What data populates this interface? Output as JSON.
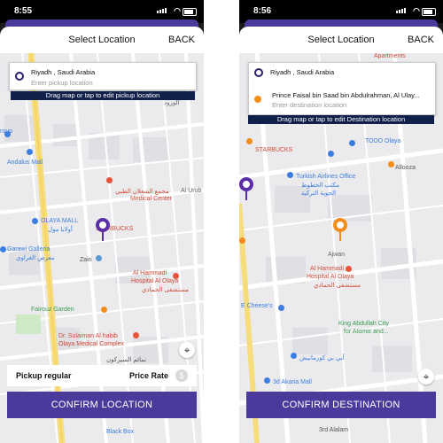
{
  "colors": {
    "accent": "#4b3a9c",
    "navy": "#10204a",
    "orange": "#f28c1a",
    "pin_purple": "#5a2ea6"
  },
  "left": {
    "status": {
      "time": "8:55"
    },
    "header": {
      "title": "Select Location",
      "back": "BACK"
    },
    "pickup": {
      "text": "Riyadh , Saudi Arabia",
      "placeholder": "Enter pickup location"
    },
    "hint": "Drag map or tap to edit pickup location",
    "map_labels": {
      "l1": "roup",
      "l2": "Andalus Mall",
      "l3": "OLAYA MALL",
      "l4": "Garawi Galleria",
      "l5": "معرض الغراوي",
      "l6": "STARBUCKS",
      "l7": "مجمع الشعلان الطبي",
      "l8": "Medical Center",
      "l9": "Al Hammadi",
      "l10": "Hospital Al Olaya",
      "l11": "مستشفى الحمادي",
      "l12": "Zain",
      "l13": "Fairouz Garden",
      "l14": "Dr. Sulaiman Al habib",
      "l15": "Olaya Medical Complex",
      "l16": "نمائم السيركون",
      "l17": "Black Box",
      "l18": "Al Urub",
      "l19": "الورود",
      "l20": "أولايا مول"
    },
    "info": {
      "left": "Pickup regular",
      "right": "Price Rate",
      "coin_icon": "$"
    },
    "confirm": "CONFIRM LOCATION"
  },
  "right": {
    "status": {
      "time": "8:56"
    },
    "header": {
      "title": "Select Location",
      "back": "BACK"
    },
    "pickup": {
      "text": "Riyadh , Saudi Arabia"
    },
    "destination": {
      "text": "Prince Faisal bin Saad bin Abdulrahman, Al Ulay...",
      "placeholder": "Enter destination location"
    },
    "hint": "Drag map or tap to edit Destination location",
    "map_labels": {
      "r1": "Apartments",
      "r2": "STARBUCKS",
      "r3": "TODO Olaya",
      "r4": "Turkish Airlines Office",
      "r5": "مكتب الخطوط",
      "r6": "الجوية التركية",
      "r7": "Allooza",
      "r8": "Al Hammadi",
      "r9": "Hospital Al Olaya",
      "r10": "مستشفى الحمادي",
      "r11": "E Cheese's",
      "r12": "King Abdullah City",
      "r13": "for Atomic and...",
      "r14": "أبي بي كورمانيش",
      "r15": "3rd Alalam",
      "r16": "3d Akaria Mall",
      "r17": "Ajwan"
    },
    "confirm": "CONFIRM DESTINATION"
  }
}
